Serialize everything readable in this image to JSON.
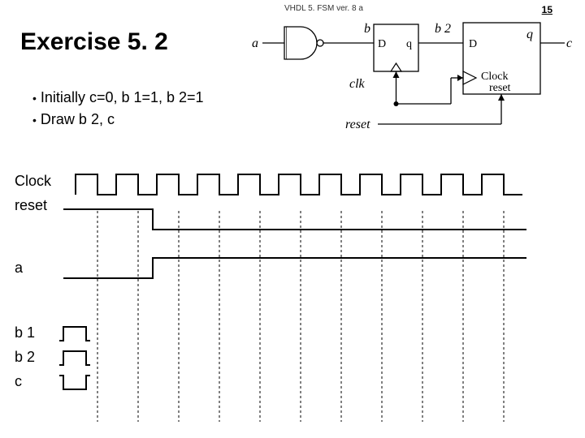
{
  "header": "VHDL 5. FSM ver. 8 a",
  "page_number": "15",
  "title": "Exercise 5. 2",
  "bullets": [
    "Initially c=0, b 1=1, b 2=1",
    "Draw b 2, c"
  ],
  "circuit": {
    "input_a": "a",
    "wire_b1": "b 1",
    "wire_b2": "b 2",
    "wire_clk": "clk",
    "wire_reset": "reset",
    "ff1_D": "D",
    "ff1_q": "q",
    "ff2_D": "D",
    "ff2_q": "q",
    "out_c": "c",
    "ff2_clock": "Clock",
    "ff2_reset": " reset"
  },
  "waveforms": {
    "clock_label": "Clock",
    "reset_label": "reset",
    "a_label": "a",
    "b1_label": "b 1",
    "b2_label": "b 2",
    "c_label": "c"
  },
  "chart_data": {
    "type": "table",
    "description": "Timing diagram with clock edges and signal traces",
    "clock_periods": 11,
    "signals": [
      {
        "name": "Clock",
        "pattern": "11 square-wave periods"
      },
      {
        "name": "reset",
        "partial": true,
        "high_until_edge": 1.5
      },
      {
        "name": "a",
        "partial": true,
        "low_then_high_at_edge": 1.5
      },
      {
        "name": "b1",
        "partial": true,
        "initial": 1
      },
      {
        "name": "b2",
        "partial": true,
        "initial": 1
      },
      {
        "name": "c",
        "partial": true,
        "initial": 0
      }
    ]
  }
}
